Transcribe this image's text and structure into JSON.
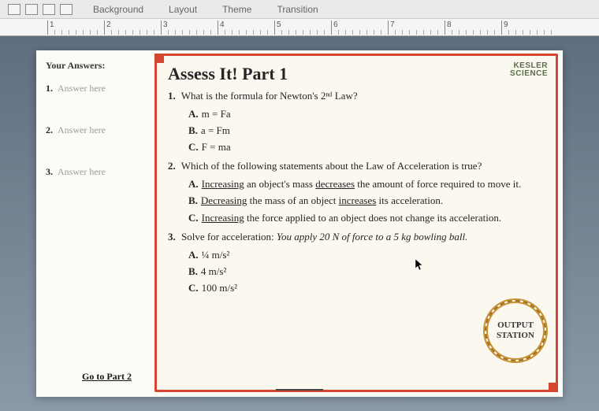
{
  "toolbar": {
    "items": [
      "Background",
      "Layout",
      "Theme",
      "Transition"
    ]
  },
  "ruler": {
    "marks": [
      1,
      2,
      3,
      4,
      5,
      6,
      7,
      8,
      9
    ]
  },
  "answers": {
    "title": "Your Answers:",
    "rows": [
      {
        "num": "1.",
        "ph": "Answer here"
      },
      {
        "num": "2.",
        "ph": "Answer here"
      },
      {
        "num": "3.",
        "ph": "Answer here"
      }
    ],
    "goto": "Go to Part 2"
  },
  "brand": {
    "line1": "KESLER",
    "line2": "SCIENCE"
  },
  "title": "Assess It!  Part 1",
  "q1": {
    "prompt": "What is the formula for Newton's 2ⁿᵈ Law?",
    "opts": {
      "A": "m = Fa",
      "B": "a = Fm",
      "C": "F = ma"
    }
  },
  "q2": {
    "prompt": "Which of the following statements about the Law of Acceleration is true?",
    "A_pre": "Increasing",
    "A_mid": " an object's mass ",
    "A_dec": "decreases",
    "A_post": " the amount of force required to move it.",
    "B_pre": "Decreasing",
    "B_mid": " the mass of an object ",
    "B_inc": "increases",
    "B_post": " its acceleration.",
    "C_pre": "Increasing",
    "C_post": " the force applied to an object does not change its acceleration."
  },
  "q3": {
    "prompt_lead": "Solve for acceleration: ",
    "prompt_ital": "You apply 20 N of force to a 5 kg bowling ball.",
    "opts": {
      "A": "¼ m/s²",
      "B": "4 m/s²",
      "C": "100 m/s²"
    }
  },
  "stamp": {
    "line1": "OUTPUT",
    "line2": "STATION"
  }
}
